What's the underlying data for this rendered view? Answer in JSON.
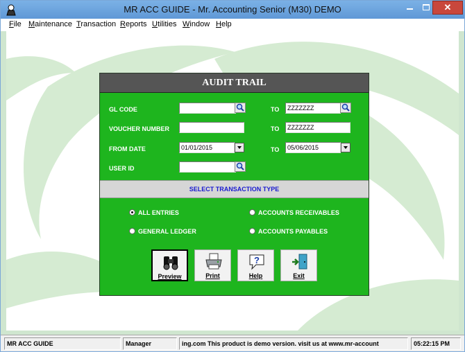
{
  "window": {
    "title": "MR ACC GUIDE - Mr. Accounting Senior (M30) DEMO",
    "close_glyph": "✕"
  },
  "menubar": {
    "items": [
      "File",
      "Maintenance",
      "Transaction",
      "Reports",
      "Utilities",
      "Window",
      "Help"
    ]
  },
  "dialog": {
    "title": "AUDIT TRAIL",
    "fields": {
      "gl_code": {
        "label": "GL CODE",
        "from": "",
        "to_label": "TO",
        "to": "ZZZZZZZ"
      },
      "voucher": {
        "label": "VOUCHER NUMBER",
        "from": "",
        "to_label": "TO",
        "to": "ZZZZZZZ"
      },
      "date": {
        "label": "FROM DATE",
        "from": "01/01/2015",
        "to_label": "TO",
        "to": "05/06/2015"
      },
      "user": {
        "label": "USER ID",
        "value": ""
      }
    },
    "section_title": "SELECT TRANSACTION TYPE",
    "radios": [
      {
        "label": "ALL ENTRIES",
        "checked": true
      },
      {
        "label": "ACCOUNTS RECEIVABLES",
        "checked": false
      },
      {
        "label": "GENERAL LEDGER",
        "checked": false
      },
      {
        "label": "ACCOUNTS PAYABLES",
        "checked": false
      }
    ],
    "buttons": {
      "preview": "Preview",
      "print": "Print",
      "help": "Help",
      "exit": "Exit"
    }
  },
  "statusbar": {
    "app": "MR ACC GUIDE",
    "user": "Manager",
    "message": "ing.com This product is demo version.  visit us at www.mr-account",
    "time": "05:22:15 PM"
  },
  "colors": {
    "dialog_bg": "#1eb51e",
    "header_bg": "#555555",
    "section_text": "#1a1ad0"
  }
}
